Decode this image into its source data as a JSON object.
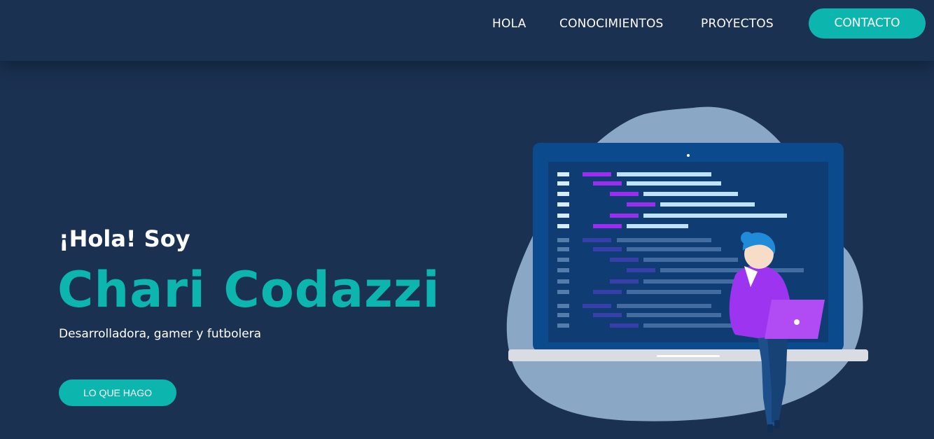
{
  "nav": {
    "items": [
      "HOLA",
      "CONOCIMIENTOS",
      "PROYECTOS"
    ],
    "contact_label": "CONTACTO"
  },
  "hero": {
    "greeting": "¡Hola! Soy",
    "name": "Chari Codazzi",
    "tagline": "Desarrolladora, gamer y futbolera",
    "cta_label": "LO QUE HAGO"
  },
  "colors": {
    "background": "#1b3151",
    "accent": "#0cb6ae",
    "blob": "#8aa8c5",
    "laptop_screen": "#0a3f7a",
    "code_purple": "#9b2cf0"
  },
  "illustration": {
    "icon": "developer-laptop-illustration"
  }
}
